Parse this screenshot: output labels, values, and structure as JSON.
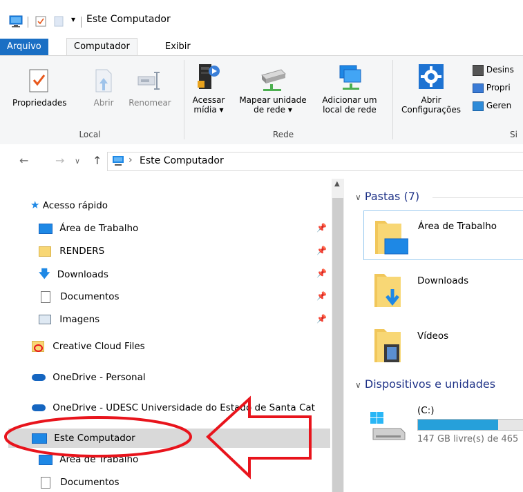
{
  "window": {
    "title": "Este Computador"
  },
  "tabs": [
    {
      "label": "Arquivo"
    },
    {
      "label": "Computador"
    },
    {
      "label": "Exibir"
    }
  ],
  "ribbon": {
    "local": {
      "label": "Local",
      "propriedades": "Propriedades",
      "abrir": "Abrir",
      "renomear": "Renomear"
    },
    "rede": {
      "label": "Rede",
      "acessar_midia_1": "Acessar",
      "acessar_midia_2": "mídia ▾",
      "mapear_1": "Mapear unidade",
      "mapear_2": "de rede ▾",
      "adicionar_1": "Adicionar um",
      "adicionar_2": "local de rede"
    },
    "sistema": {
      "label": "Si",
      "abrir_config_1": "Abrir",
      "abrir_config_2": "Configurações",
      "desinstalar": "Desins",
      "propriedades": "Propri",
      "gerenciar": "Geren"
    }
  },
  "address": {
    "path": "Este Computador",
    "separator": "›"
  },
  "navpane": {
    "acesso_rapido": "Acesso rápido",
    "quick": [
      {
        "label": "Área de Trabalho"
      },
      {
        "label": "RENDERS"
      },
      {
        "label": "Downloads"
      },
      {
        "label": "Documentos"
      },
      {
        "label": "Imagens"
      }
    ],
    "creative_cloud": "Creative Cloud Files",
    "onedrive_personal": "OneDrive - Personal",
    "onedrive_udesc": "OneDrive - UDESC Universidade do Estado de Santa Cat",
    "este_computador": "Este Computador",
    "pc_children": [
      {
        "label": "Área de Trabalho"
      },
      {
        "label": "Documentos"
      }
    ]
  },
  "content": {
    "pastas_header": "Pastas (7)",
    "folders": [
      {
        "label": "Área de Trabalho"
      },
      {
        "label": "Downloads"
      },
      {
        "label": "Vídeos"
      }
    ],
    "devices_header": "Dispositivos e unidades",
    "drive": {
      "label": "(C:)",
      "free": "147 GB livre(s) de 465",
      "used_fraction": 0.68
    }
  },
  "colors": {
    "accent": "#1a6fc4",
    "annotation": "#e8141c",
    "drive_bar": "#26a0da"
  }
}
